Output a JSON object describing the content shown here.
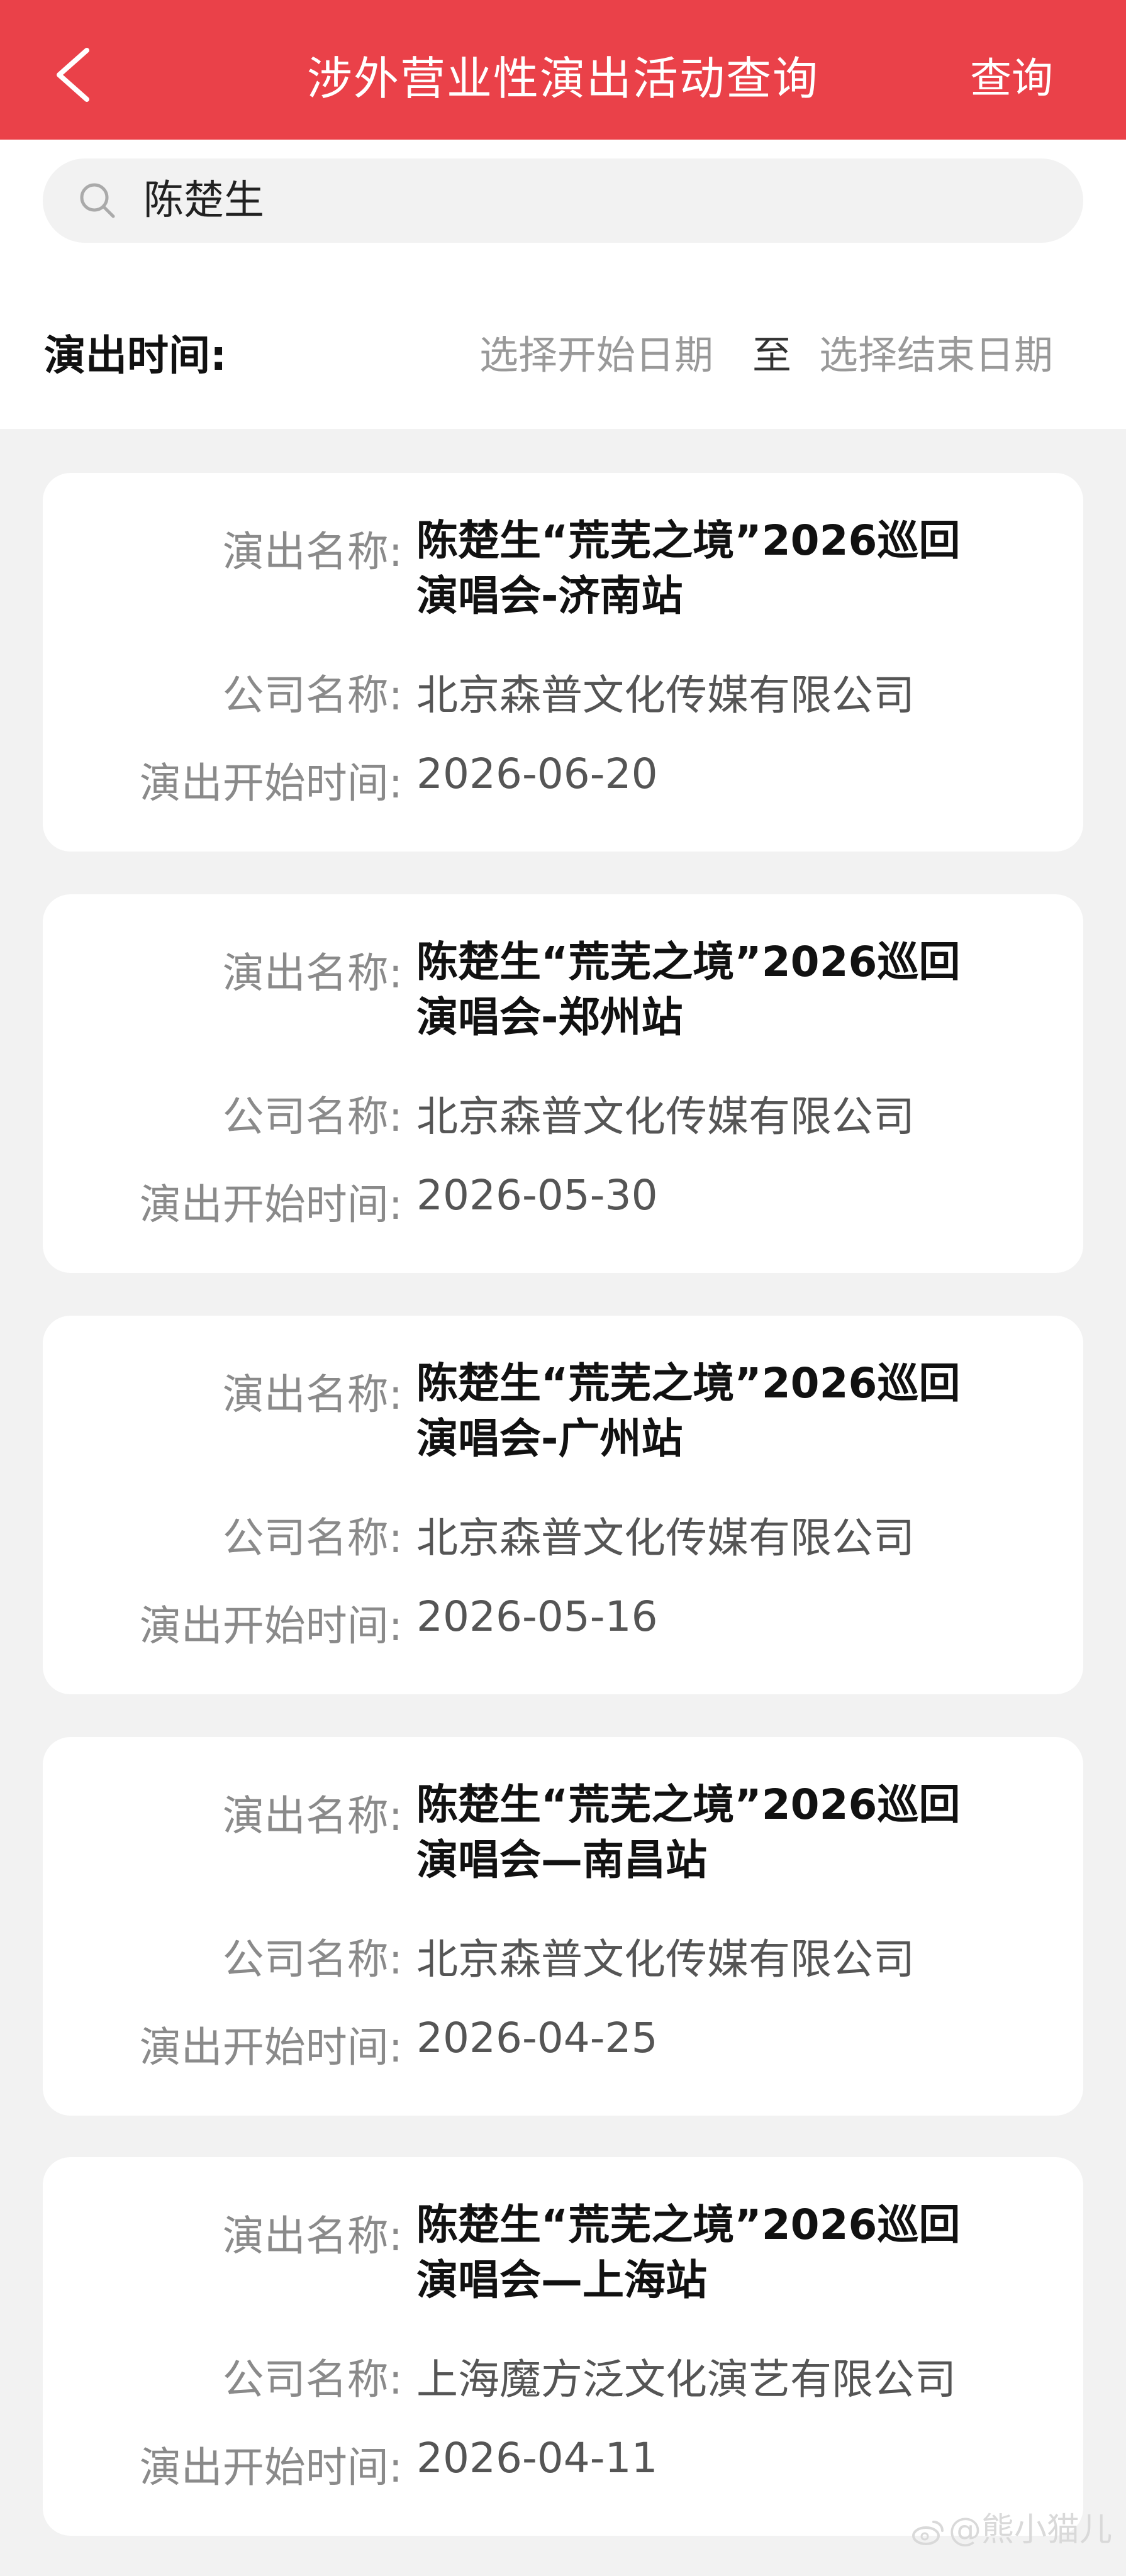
{
  "header": {
    "title": "涉外营业性演出活动查询",
    "query_label": "查询"
  },
  "search": {
    "value": "陈楚生"
  },
  "date_filter": {
    "label": "演出时间:",
    "start_placeholder": "选择开始日期",
    "separator": "至",
    "end_placeholder": "选择结束日期"
  },
  "labels": {
    "name": "演出名称:",
    "company": "公司名称:",
    "start_time": "演出开始时间:"
  },
  "results": [
    {
      "name_line1": "陈楚生“荒芜之境”2026巡回",
      "name_line2": "演唱会-济南站",
      "company": "北京森普文化传媒有限公司",
      "start_date": "2026-06-20"
    },
    {
      "name_line1": "陈楚生“荒芜之境”2026巡回",
      "name_line2": "演唱会-郑州站",
      "company": "北京森普文化传媒有限公司",
      "start_date": "2026-05-30"
    },
    {
      "name_line1": "陈楚生“荒芜之境”2026巡回",
      "name_line2": "演唱会-广州站",
      "company": "北京森普文化传媒有限公司",
      "start_date": "2026-05-16"
    },
    {
      "name_line1": "陈楚生“荒芜之境”2026巡回",
      "name_line2": "演唱会—南昌站",
      "company": "北京森普文化传媒有限公司",
      "start_date": "2026-04-25"
    },
    {
      "name_line1": "陈楚生“荒芜之境”2026巡回",
      "name_line2": "演唱会—上海站",
      "company": "上海魔方泛文化演艺有限公司",
      "start_date": "2026-04-11"
    }
  ],
  "watermark": "@熊小猫儿",
  "colors": {
    "header_bg": "#ea4149",
    "page_bg": "#f2f2f2"
  },
  "icons": [
    "back-icon",
    "search-icon",
    "weibo-icon"
  ]
}
